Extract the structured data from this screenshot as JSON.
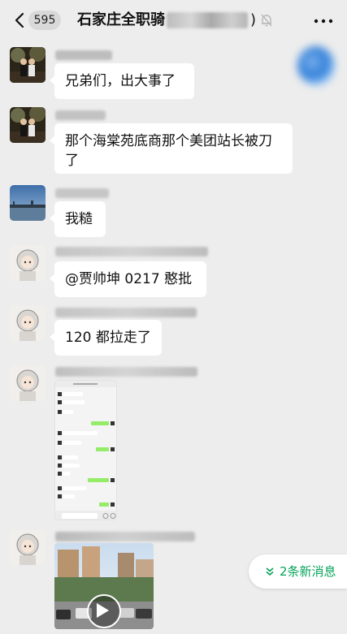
{
  "header": {
    "back_icon": "chevron-left-icon",
    "unread_count": "595",
    "group_title": "石家庄全职骑",
    "title_close": ")",
    "mute_icon": "bell-off-icon",
    "more_icon": "more-dots-icon"
  },
  "messages": [
    {
      "text": "兄弟们，出大事了"
    },
    {
      "text": "那个海棠苑底商那个美团站长被刀了"
    },
    {
      "text": "我糙"
    },
    {
      "text": "@贾帅坤 0217  憨批"
    },
    {
      "text": "120 都拉走了"
    }
  ],
  "new_messages": {
    "icon": "double-chevron-down-icon",
    "label": "2条新消息"
  },
  "colors": {
    "background": "#ededed",
    "bubble": "#ffffff",
    "accent_green": "#07a35a",
    "sent_bubble_green": "#95ec69"
  }
}
